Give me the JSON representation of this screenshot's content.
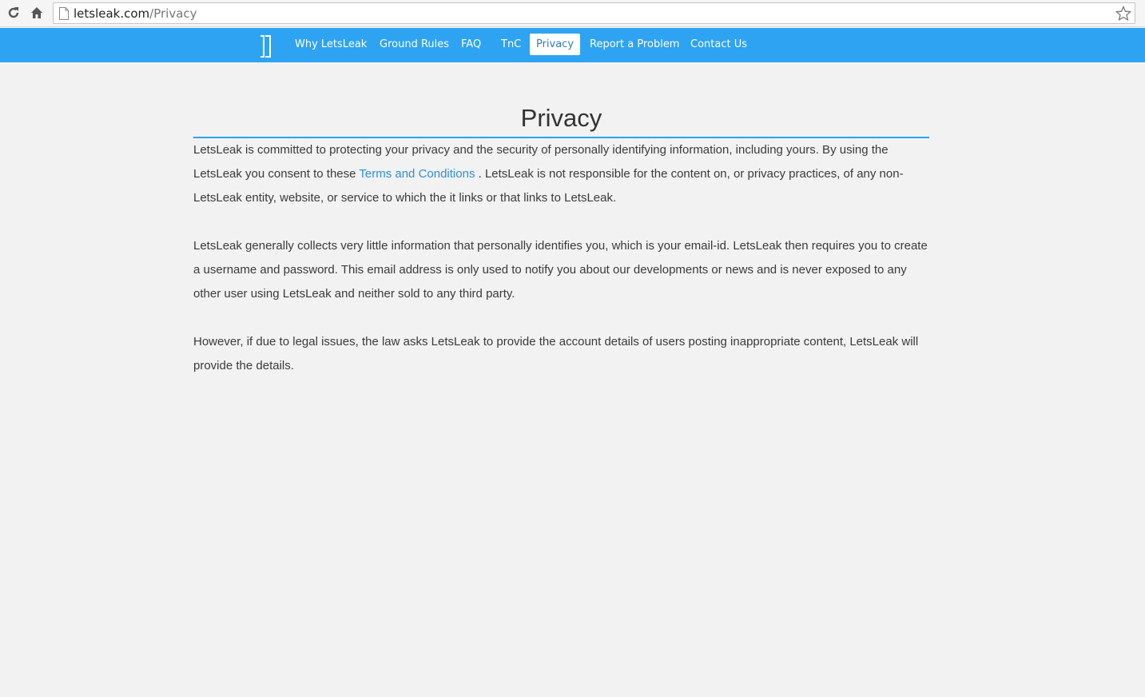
{
  "browser": {
    "url_domain": "letsleak.com",
    "url_path": "/Privacy",
    "icons": {
      "reload": "reload-icon",
      "home": "home-icon",
      "page": "page-icon",
      "bookmark": "star-icon"
    }
  },
  "navbar": {
    "color": "#2ea3f2",
    "logo_icon": "letsleak-logo",
    "items": [
      {
        "label": "Why LetsLeak",
        "active": false
      },
      {
        "label": "Ground Rules",
        "active": false
      },
      {
        "label": "FAQ",
        "active": false
      },
      {
        "label": "TnC",
        "active": false
      },
      {
        "label": "Privacy",
        "active": true
      },
      {
        "label": "Report a Problem",
        "active": false
      },
      {
        "label": "Contact Us",
        "active": false
      }
    ]
  },
  "page": {
    "title": "Privacy",
    "p1_before": "LetsLeak is committed to protecting your privacy and the security of personally identifying information, including yours. By using the LetsLeak you consent to these ",
    "p1_link": "Terms and Conditions",
    "p1_after": " . LetsLeak is not responsible for the content on, or privacy practices, of any non-LetsLeak entity, website, or service to which the it links or that links to LetsLeak.",
    "p2": "LetsLeak generally collects very little information that personally identifies you, which is your email-id. LetsLeak then requires you to create a username and password. This email address is only used to notify you about our developments or news and is never exposed to any other user using LetsLeak and neither sold to any third party.",
    "p3": "However, if due to legal issues, the law asks LetsLeak to provide the account details of users posting inappropriate content, LetsLeak will provide the details."
  }
}
